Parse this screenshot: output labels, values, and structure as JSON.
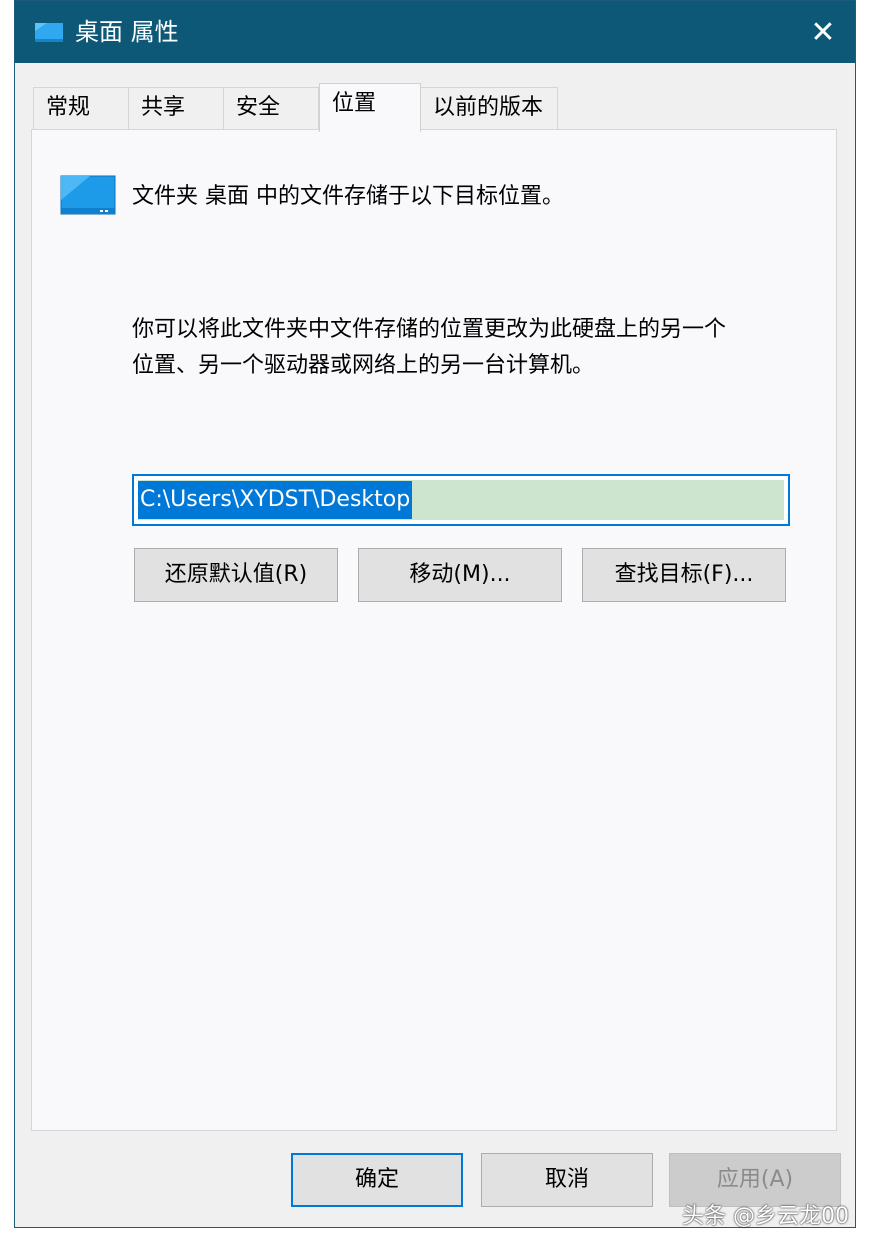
{
  "window": {
    "title": "桌面 属性",
    "close_glyph": "✕"
  },
  "tabs": [
    {
      "label": "常规"
    },
    {
      "label": "共享"
    },
    {
      "label": "安全"
    },
    {
      "label": "位置",
      "active": true
    },
    {
      "label": "以前的版本"
    }
  ],
  "panel": {
    "folder_description": "文件夹 桌面 中的文件存储于以下目标位置。",
    "info_line1": "你可以将此文件夹中文件存储的位置更改为此硬盘上的另一个",
    "info_line2": "位置、另一个驱动器或网络上的另一台计算机。",
    "path_value": "C:\\Users\\XYDST\\Desktop",
    "restore_default_label": "还原默认值(R)",
    "move_label": "移动(M)...",
    "find_target_label": "查找目标(F)..."
  },
  "footer": {
    "ok_label": "确定",
    "cancel_label": "取消",
    "apply_label": "应用(A)"
  },
  "watermark": "头条 @乡云龙00",
  "colors": {
    "titlebar": "#0e5877",
    "selection": "#0078d7",
    "dialog_bg": "#f0f0f0",
    "panel_bg": "#f9f9fb"
  },
  "icons": {
    "title_icon": "desktop-folder-icon",
    "folder_icon": "desktop-folder-icon",
    "close_icon": "close-icon"
  }
}
